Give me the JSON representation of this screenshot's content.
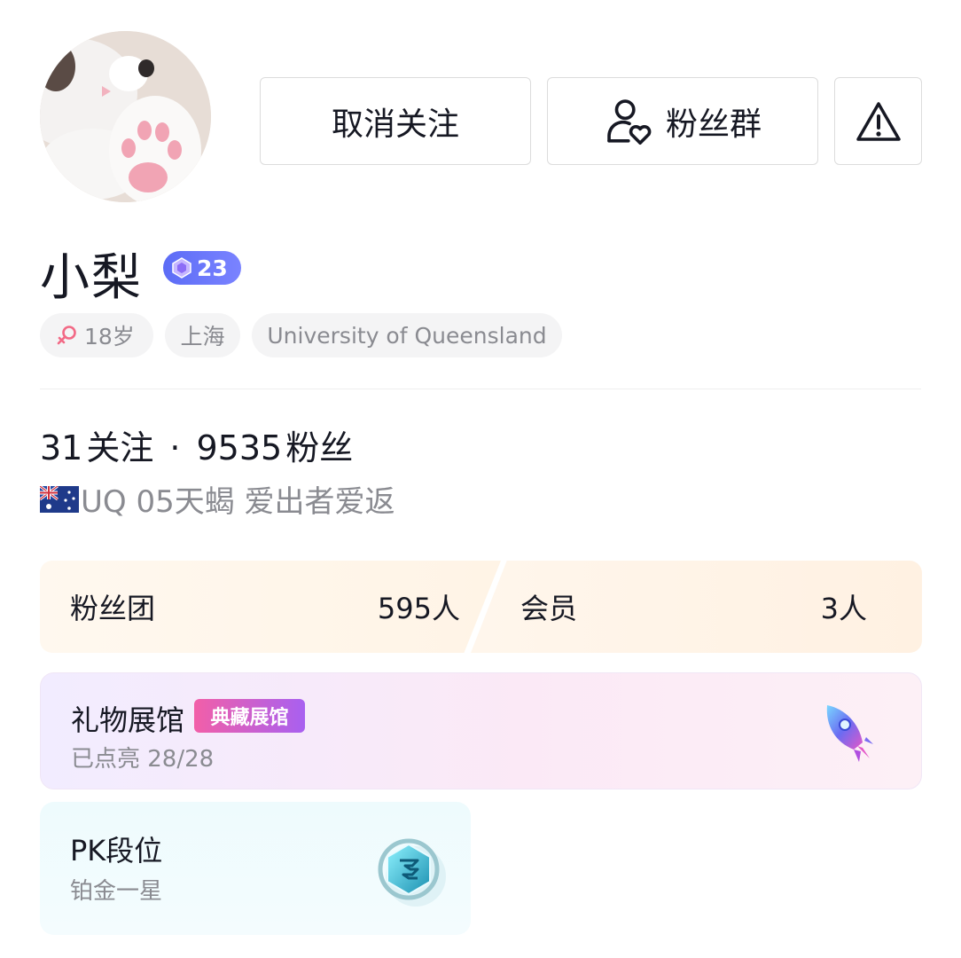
{
  "profile": {
    "name": "小梨",
    "level": "23",
    "avatar_icon": "cat-paw-avatar"
  },
  "actions": {
    "unfollow_label": "取消关注",
    "fan_group_label": "粉丝群",
    "fan_group_icon": "user-heart-icon",
    "report_icon": "warning-icon"
  },
  "tags": {
    "age": "18岁",
    "gender_icon": "female-icon",
    "city": "上海",
    "school": "University of Queensland"
  },
  "stats": {
    "following_count": "31",
    "following_label": "关注",
    "separator": "·",
    "followers_count": "9535",
    "followers_label": "粉丝"
  },
  "bio": {
    "flag_icon": "australia-flag-icon",
    "text": "UQ 05天蝎 爱出者爱返"
  },
  "fan_club": {
    "label": "粉丝团",
    "count": "595人"
  },
  "members": {
    "label": "会员",
    "count": "3人"
  },
  "gift_hall": {
    "title": "礼物展馆",
    "badge": "典藏展馆",
    "progress_text": "已点亮 28/28",
    "progress": 1.0,
    "icon": "rocket-gift-icon"
  },
  "pk_rank": {
    "title": "PK段位",
    "rank": "铂金一星",
    "icon": "platinum-rank-icon"
  },
  "colors": {
    "level_badge": "#5c6cf6",
    "gift_badge_start": "#f25fa8",
    "gift_badge_end": "#a860f0",
    "secondary_text": "#8a8b91"
  }
}
